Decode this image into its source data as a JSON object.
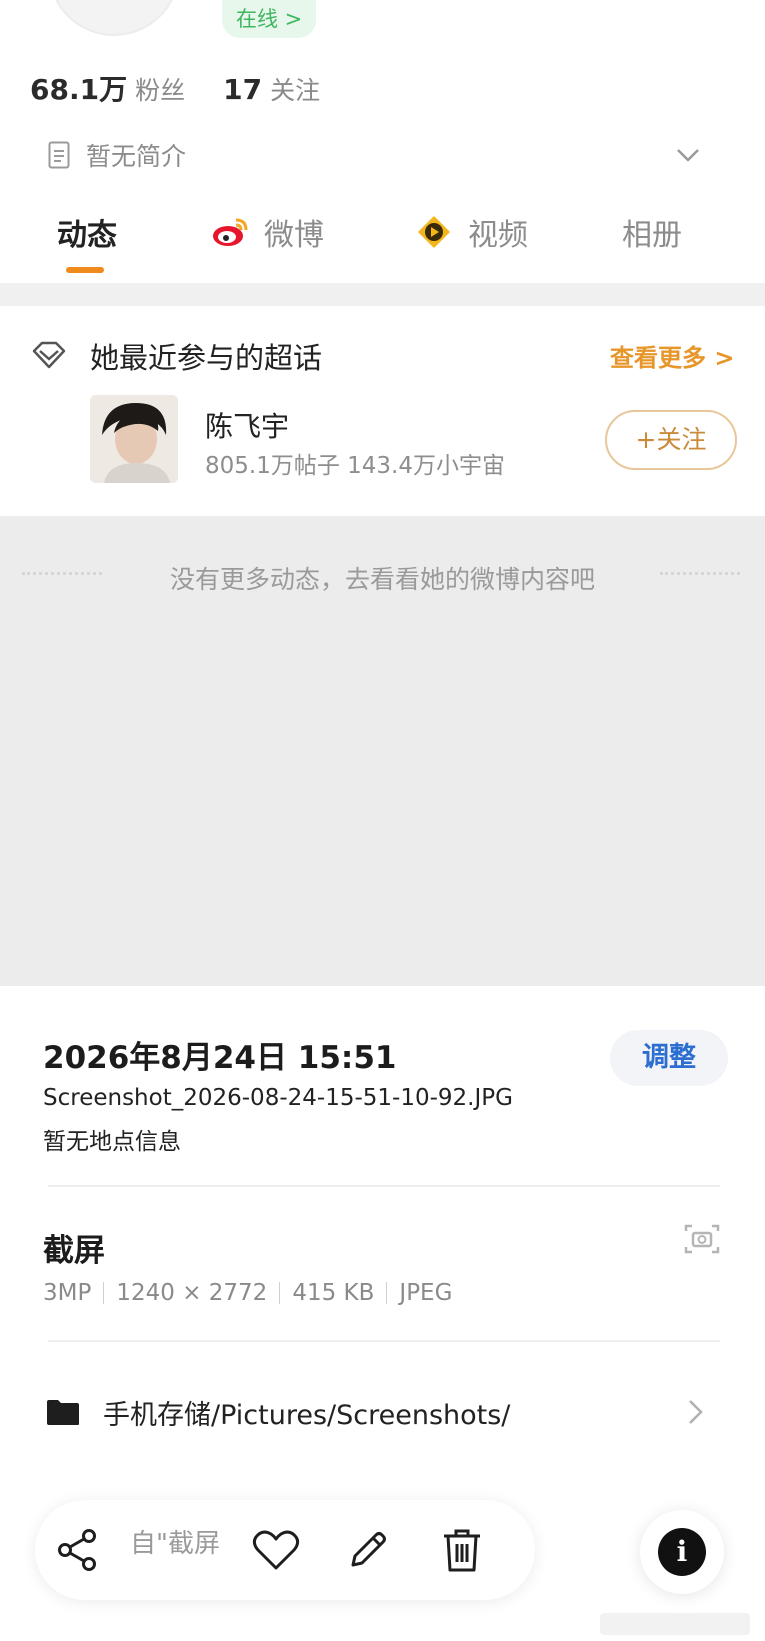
{
  "profile": {
    "status": "在线 >",
    "followers_num": "68.1万",
    "followers_label": "粉丝",
    "following_num": "17",
    "following_label": "关注",
    "bio": "暂无简介"
  },
  "tabs": [
    {
      "label": "动态",
      "active": true
    },
    {
      "label": "微博",
      "icon": "weibo-icon"
    },
    {
      "label": "视频",
      "icon": "video-icon"
    },
    {
      "label": "相册"
    }
  ],
  "super_topic": {
    "title": "她最近参与的超话",
    "more": "查看更多 >",
    "name": "陈飞宇",
    "meta": "805.1万帖子 143.4万小宇宙",
    "follow": "+关注"
  },
  "empty_message": "没有更多动态，去看看她的微博内容吧",
  "photo_info": {
    "datetime": "2026年8月24日 15:51",
    "adjust": "调整",
    "filename": "Screenshot_2026-08-24-15-51-10-92.JPG",
    "location": "暂无地点信息",
    "source_title": "截屏",
    "specs": [
      "3MP",
      "1240 × 2772",
      "415 KB",
      "JPEG"
    ],
    "path": "手机存储/Pictures/Screenshots/"
  },
  "toolbar": {
    "source_text": "自\"截屏",
    "icons": [
      "share-icon",
      "heart-icon",
      "edit-icon",
      "delete-icon",
      "info-icon"
    ],
    "info_glyph": "i"
  },
  "colors": {
    "accent_orange": "#f08a1c",
    "link_blue": "#2c6fd1",
    "online_green": "#3fb760"
  }
}
